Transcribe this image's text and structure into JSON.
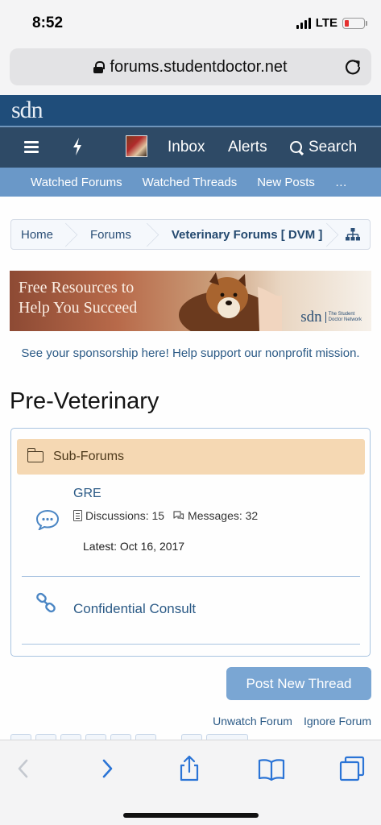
{
  "status_bar": {
    "time": "8:52",
    "network": "LTE"
  },
  "browser": {
    "url": "forums.studentdoctor.net"
  },
  "site": {
    "logo": "sdn"
  },
  "nav": {
    "inbox": "Inbox",
    "alerts": "Alerts",
    "search": "Search"
  },
  "subnav": {
    "items": [
      "Watched Forums",
      "Watched Threads",
      "New Posts",
      "…"
    ]
  },
  "breadcrumb": {
    "items": [
      "Home",
      "Forums",
      "Veterinary Forums [ DVM ]"
    ]
  },
  "banner": {
    "line1": "Free Resources to",
    "line2": "Help You Succeed",
    "logo": "sdn",
    "logo_tag_line1": "The Student",
    "logo_tag_line2": "Doctor Network"
  },
  "sponsor_text": "See your sponsorship here! Help support our nonprofit mission.",
  "page_title": "Pre-Veterinary",
  "subforums": {
    "heading": "Sub-Forums",
    "nodes": [
      {
        "title": "GRE",
        "discussions": "Discussions: 15",
        "messages": "Messages: 32",
        "latest": "Latest: Oct 16, 2017"
      },
      {
        "title": "Confidential Consult"
      }
    ]
  },
  "actions": {
    "post_new_thread": "Post New Thread",
    "unwatch": "Unwatch Forum",
    "ignore": "Ignore Forum"
  },
  "colors": {
    "header": "#1f4d7a",
    "navbar": "#2e4a66",
    "subnav": "#6a98c8",
    "accent_link": "#2b5a86",
    "subforum_head": "#f5d8b3",
    "button": "#7aa6d3"
  }
}
